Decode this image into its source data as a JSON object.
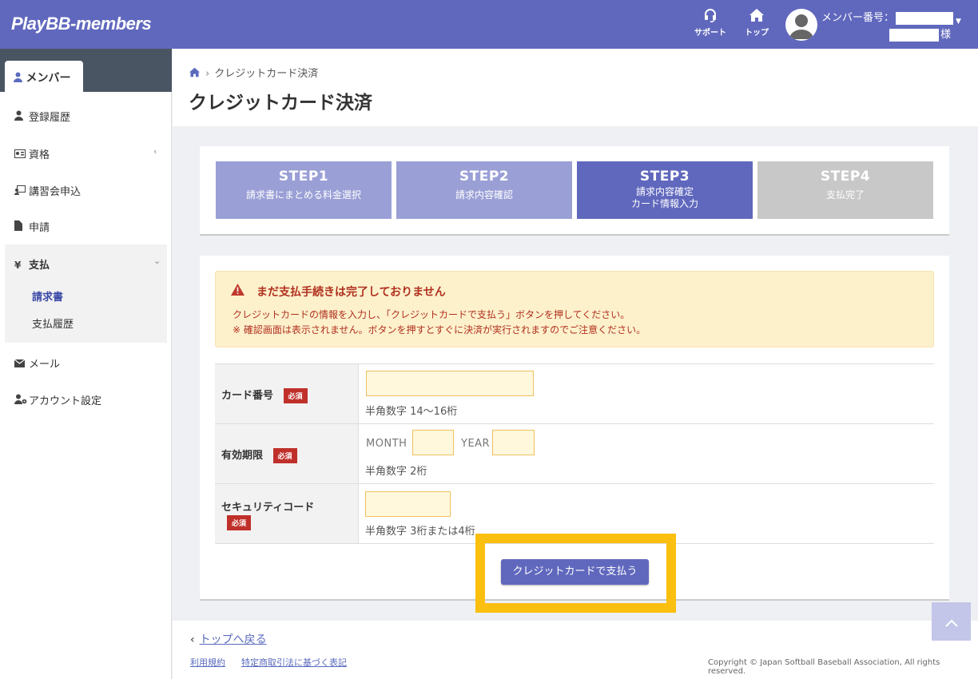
{
  "header": {
    "logo": "PlayBB-members",
    "support_label": "サポート",
    "top_label": "トップ",
    "member_label": "メンバー番号：",
    "member_suffix": "様"
  },
  "sidebar": {
    "active_tab": "メンバー",
    "items": [
      {
        "label": "登録履歴",
        "icon": "user-icon"
      },
      {
        "label": "資格",
        "icon": "id-card-icon"
      },
      {
        "label": "講習会申込",
        "icon": "chalkboard-icon"
      },
      {
        "label": "申請",
        "icon": "file-icon"
      },
      {
        "label": "支払",
        "icon": "yen-icon"
      },
      {
        "label": "メール",
        "icon": "envelope-icon"
      },
      {
        "label": "アカウント設定",
        "icon": "user-cog-icon"
      }
    ],
    "sub_items": [
      "請求書",
      "支払履歴"
    ]
  },
  "breadcrumb": {
    "current": "クレジットカード決済"
  },
  "page_title": "クレジットカード決済",
  "steps": [
    {
      "title": "STEP1",
      "desc": "請求書にまとめる料金選択",
      "color": "#9a9fd6"
    },
    {
      "title": "STEP2",
      "desc": "請求内容確認",
      "color": "#9a9fd6"
    },
    {
      "title": "STEP3",
      "desc1": "請求内容確定",
      "desc2": "カード情報入力",
      "color": "#6068bd"
    },
    {
      "title": "STEP4",
      "desc": "支払完了",
      "color": "#c8c8c8"
    }
  ],
  "alert": {
    "title": "まだ支払手続きは完了しておりません",
    "line1": "クレジットカードの情報を入力し、「クレジットカードで支払う」ボタンを押してください。",
    "line2": "※ 確認画面は表示されません。ボタンを押すとすぐに決済が実行されますのでご注意ください。"
  },
  "form": {
    "required": "必須",
    "card_number": {
      "label": "カード番号",
      "hint": "半角数字 14～16桁",
      "value": ""
    },
    "expiry": {
      "label": "有効期限",
      "month_label": "MONTH",
      "year_label": "YEAR",
      "hint": "半角数字 2桁",
      "month_value": "",
      "year_value": ""
    },
    "security": {
      "label": "セキュリティコード",
      "hint": "半角数字 3桁または4桁",
      "value": ""
    }
  },
  "pay_button": "クレジットカードで支払う",
  "footer": {
    "back": "トップへ戻る",
    "terms": "利用規約",
    "law": "特定商取引法に基づく表記",
    "copyright": "Copyright © Japan Softball Baseball Association, All rights reserved."
  },
  "colors": {
    "brand": "#6068bd",
    "highlight": "#fbbf10",
    "required": "#c0302a"
  }
}
